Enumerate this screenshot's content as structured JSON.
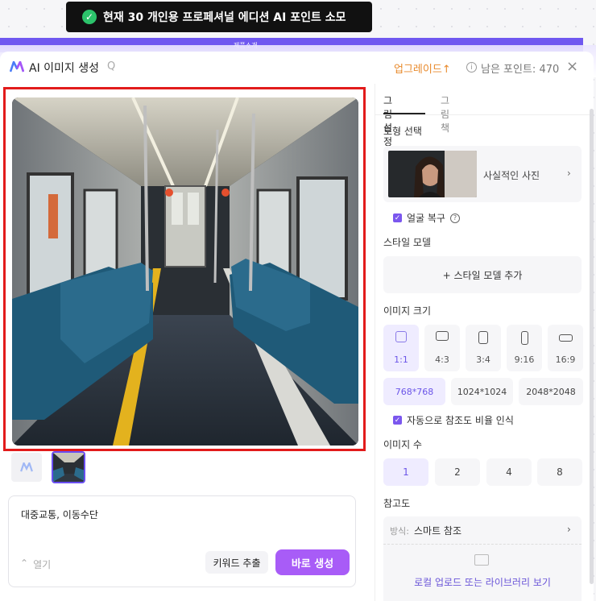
{
  "toast": {
    "icon": "check-circle-icon",
    "message": "현재 30 개인용 프로페셔널 에디션 AI 포인트 소모"
  },
  "background": {
    "strip_label": "제품소개"
  },
  "header": {
    "title": "AI 이미지 생성",
    "help": "Q",
    "upgrade": "업그레이드",
    "upgrade_icon": "↑",
    "points_label": "남은 포인트: 470",
    "close": "×"
  },
  "prompt": {
    "text": "대중교통, 이동수단",
    "expand": "열기",
    "keyword_btn": "키워드 추출",
    "generate_btn": "바로 생성"
  },
  "settings": {
    "tabs": [
      {
        "label": "그림 설정",
        "active": true
      },
      {
        "label": "그림책",
        "active": false
      }
    ],
    "model_section": "모형 선택",
    "model_name": "사실적인 사진",
    "face_restore": "얼굴 복구",
    "style_section": "스타일 모델",
    "add_style": "+ 스타일 모델 추가",
    "size_section": "이미지 크기",
    "ratios": [
      {
        "label": "1:1",
        "active": true
      },
      {
        "label": "4:3",
        "active": false
      },
      {
        "label": "3:4",
        "active": false
      },
      {
        "label": "9:16",
        "active": false
      },
      {
        "label": "16:9",
        "active": false
      }
    ],
    "sizes": [
      {
        "label": "768*768",
        "active": true
      },
      {
        "label": "1024*1024",
        "active": false
      },
      {
        "label": "2048*2048",
        "active": false
      }
    ],
    "auto_ratio": "자동으로 참조도 비율 인식",
    "count_section": "이미지 수",
    "counts": [
      {
        "label": "1",
        "active": true
      },
      {
        "label": "2",
        "active": false
      },
      {
        "label": "4",
        "active": false
      },
      {
        "label": "8",
        "active": false
      }
    ],
    "reference_section": "참고도",
    "reference_method_label": "방식:",
    "reference_method_value": "스마트 참조",
    "upload_text": "로컬 업로드 또는 라이브러리 보기"
  },
  "colors": {
    "accent": "#a85cf7",
    "upgrade": "#e8892b",
    "selection_border": "#e21b1b"
  }
}
